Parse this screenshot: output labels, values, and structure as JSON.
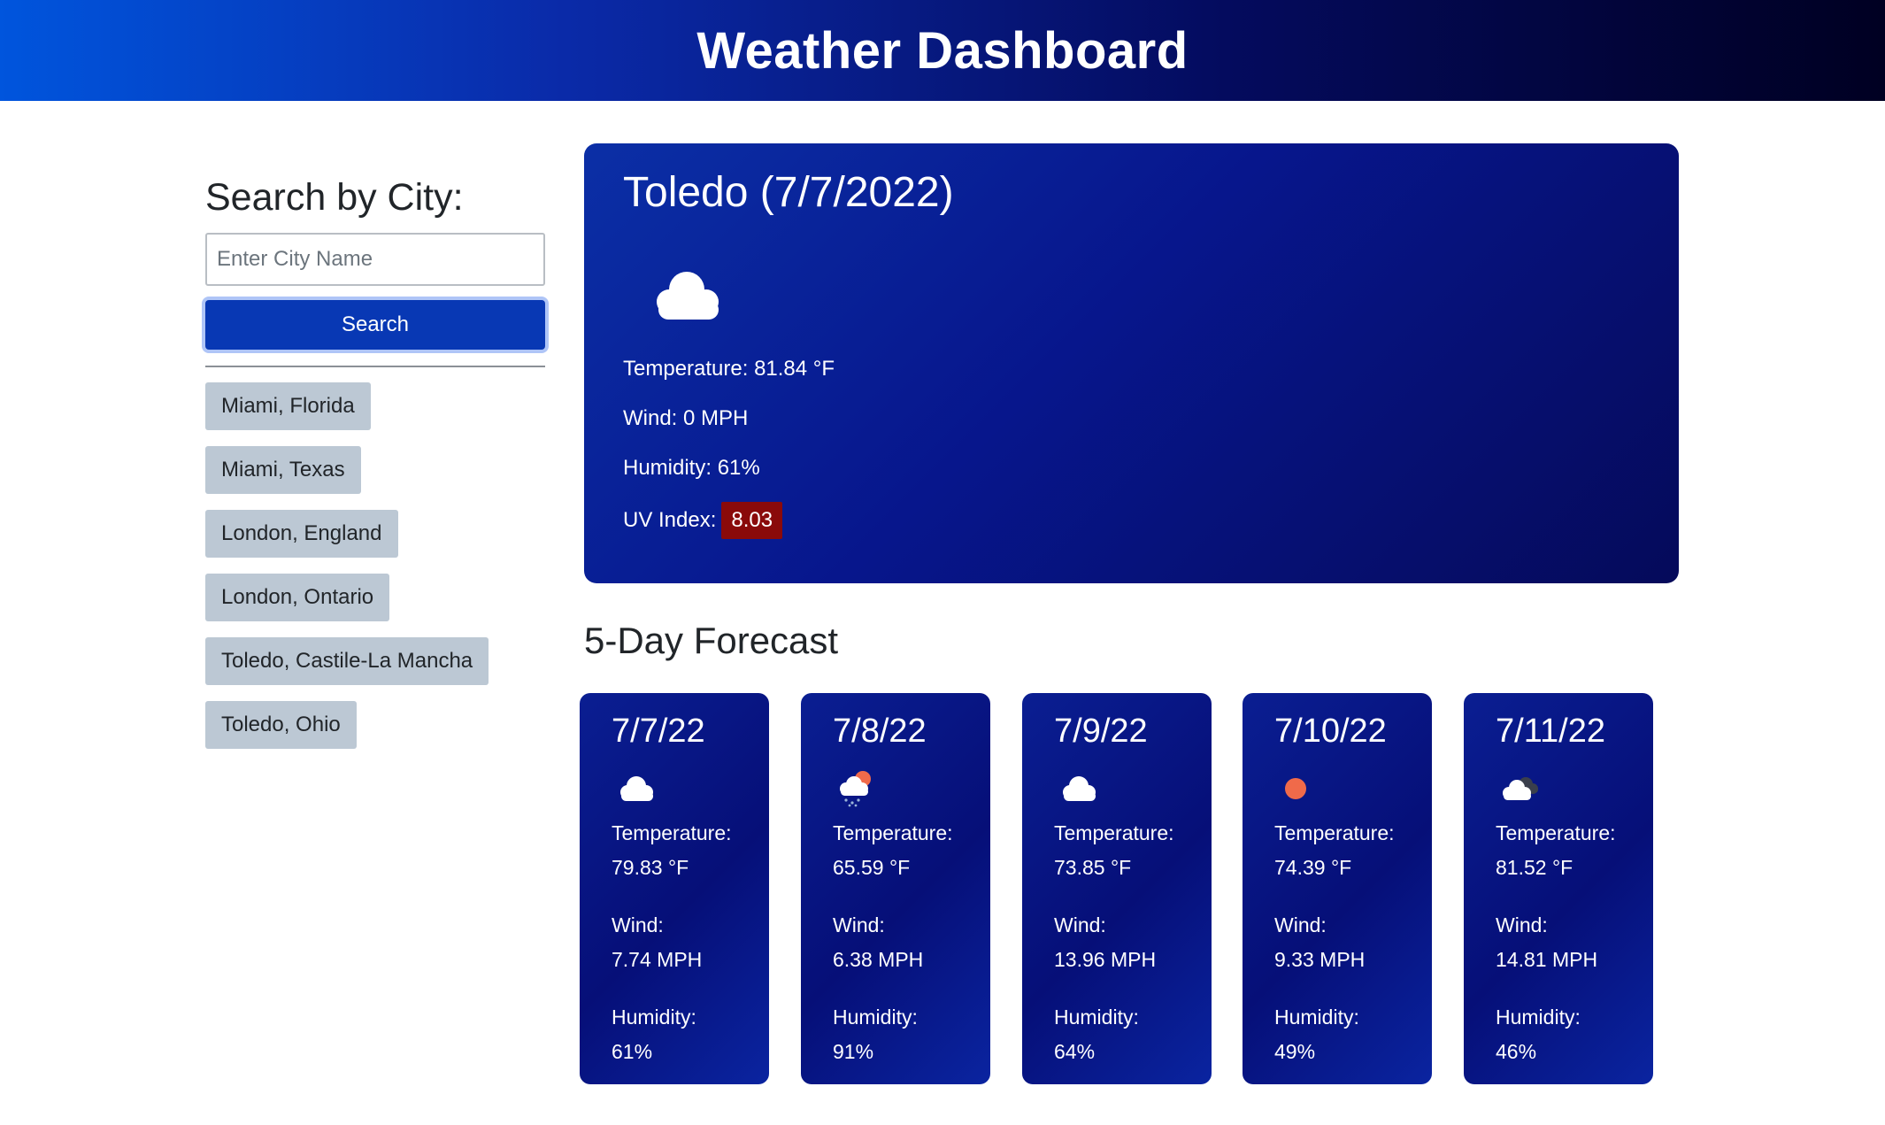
{
  "header": {
    "title": "Weather Dashboard"
  },
  "sidebar": {
    "heading": "Search by City:",
    "input_placeholder": "Enter City Name",
    "search_label": "Search",
    "history": [
      "Miami, Florida",
      "Miami, Texas",
      "London, England",
      "London, Ontario",
      "Toledo, Castile-La Mancha",
      "Toledo, Ohio"
    ]
  },
  "current": {
    "title": "Toledo (7/7/2022)",
    "icon": "cloud-icon",
    "temperature": "Temperature: 81.84 °F",
    "wind": "Wind: 0 MPH",
    "humidity": "Humidity: 61%",
    "uv_label": "UV Index:",
    "uv_value": "8.03",
    "uv_color": "#8a0a0a"
  },
  "forecast": {
    "heading": "5-Day Forecast",
    "temperature_label": "Temperature:",
    "wind_label": "Wind:",
    "humidity_label": "Humidity:",
    "days": [
      {
        "date": "7/7/22",
        "icon": "cloud-icon",
        "temp": "79.83 °F",
        "wind": "7.74 MPH",
        "humidity": "61%"
      },
      {
        "date": "7/8/22",
        "icon": "rain-sun-icon",
        "temp": "65.59 °F",
        "wind": "6.38 MPH",
        "humidity": "91%"
      },
      {
        "date": "7/9/22",
        "icon": "cloud-icon",
        "temp": "73.85 °F",
        "wind": "13.96 MPH",
        "humidity": "64%"
      },
      {
        "date": "7/10/22",
        "icon": "sun-icon",
        "temp": "74.39 °F",
        "wind": "9.33 MPH",
        "humidity": "49%"
      },
      {
        "date": "7/11/22",
        "icon": "broken-clouds-icon",
        "temp": "81.52 °F",
        "wind": "14.81 MPH",
        "humidity": "46%"
      }
    ]
  }
}
